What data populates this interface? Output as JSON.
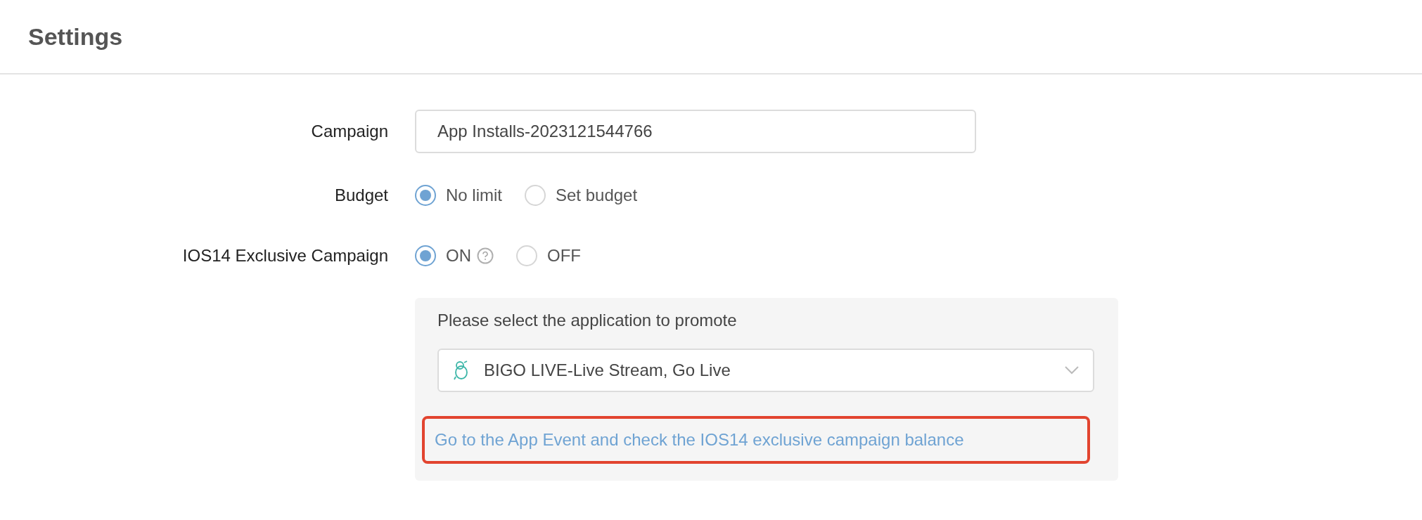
{
  "header": {
    "title": "Settings"
  },
  "form": {
    "campaign": {
      "label": "Campaign",
      "value": "App Installs-2023121544766"
    },
    "budget": {
      "label": "Budget",
      "options": [
        {
          "label": "No limit",
          "selected": true
        },
        {
          "label": "Set budget",
          "selected": false
        }
      ]
    },
    "ios14": {
      "label": "IOS14 Exclusive Campaign",
      "options": [
        {
          "label": "ON",
          "selected": true,
          "help": true
        },
        {
          "label": "OFF",
          "selected": false,
          "help": false
        }
      ]
    },
    "app_panel": {
      "prompt": "Please select the application to promote",
      "app": "BIGO LIVE-Live Stream, Go Live",
      "link": "Go to the App Event and check the IOS14 exclusive campaign balance"
    }
  }
}
